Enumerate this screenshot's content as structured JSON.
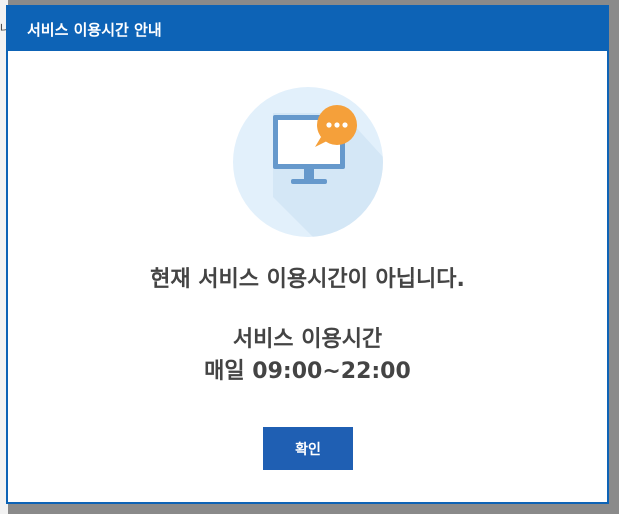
{
  "background": {
    "fragment_glyph": "냐"
  },
  "dialog": {
    "title": "서비스 이용시간 안내",
    "message": "현재 서비스 이용시간이 아닙니다.",
    "hours_label": "서비스 이용시간",
    "hours_value": "매일 09:00~22:00",
    "confirm_label": "확인",
    "icon": "monitor-with-speech-bubble-icon",
    "colors": {
      "header": "#0d63b6",
      "button": "#1f5fb3",
      "illustration_circle": "#e2f0fb",
      "monitor": "#6699cc",
      "bubble": "#f5a03a"
    }
  }
}
